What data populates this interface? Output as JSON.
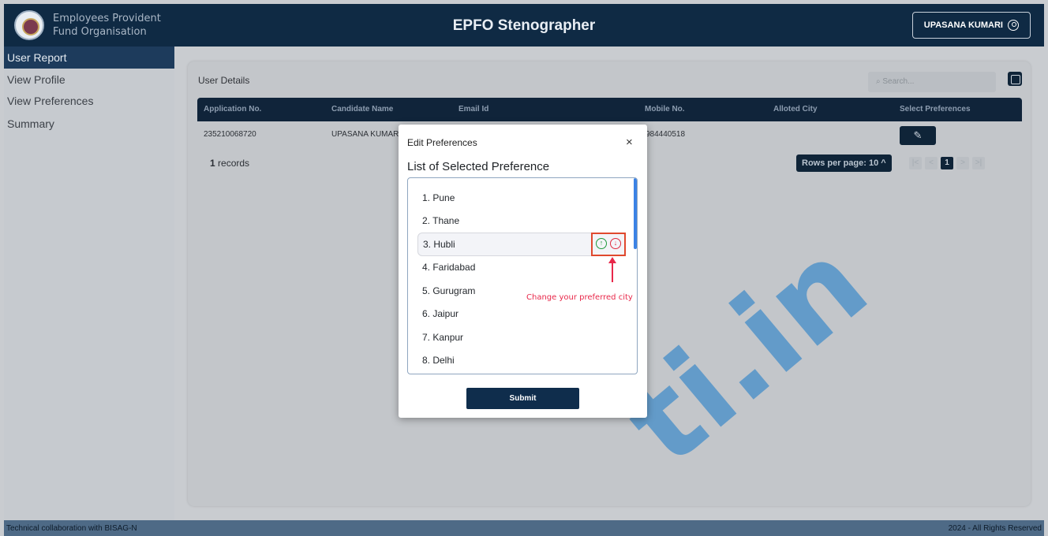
{
  "header": {
    "org_line1": "Employees Provident",
    "org_line2": "Fund Organisation",
    "app_title": "EPFO Stenographer",
    "user_name": "UPASANA KUMARI"
  },
  "sidebar": {
    "items": [
      {
        "label": "User Report",
        "active": true
      },
      {
        "label": "View Profile",
        "active": false
      },
      {
        "label": "View Preferences",
        "active": false
      },
      {
        "label": "Summary",
        "active": false
      }
    ]
  },
  "card": {
    "title": "User Details",
    "search_placeholder": "Search...",
    "columns": [
      "Application No.",
      "Candidate Name",
      "Email Id",
      "Mobile No.",
      "Alloted City",
      "Select Preferences"
    ],
    "row": {
      "application_no": "235210068720",
      "candidate_name": "UPASANA KUMAR",
      "mobile_no": "984440518"
    },
    "records_count": "1",
    "records_label": "records",
    "rows_per_page": "Rows per page: 10",
    "current_page": "1"
  },
  "modal": {
    "title": "Edit Preferences",
    "close": "×",
    "heading": "List of Selected Preference",
    "preferences": [
      "1. Pune",
      "2. Thane",
      "3. Hubli",
      "4. Faridabad",
      "5. Gurugram",
      "6. Jaipur",
      "7. Kanpur",
      "8. Delhi"
    ],
    "selected_index": 2,
    "annotation": "Change your preferred city",
    "submit_label": "Submit"
  },
  "footer": {
    "left": "Technical collaboration with BISAG-N",
    "right": "2024 - All Rights Reserved"
  },
  "icons": {
    "up": "arrow-up-circle-icon",
    "down": "arrow-down-circle-icon",
    "edit": "pencil-icon",
    "user": "user-circle-icon",
    "search": "search-icon"
  },
  "colors": {
    "header_bg": "#0f2a44",
    "up_icon": "#1f9a3c",
    "down_icon": "#e02a3e",
    "annotation": "#e8284a",
    "highlight_border": "#e0492e"
  },
  "watermark": "ti.in"
}
